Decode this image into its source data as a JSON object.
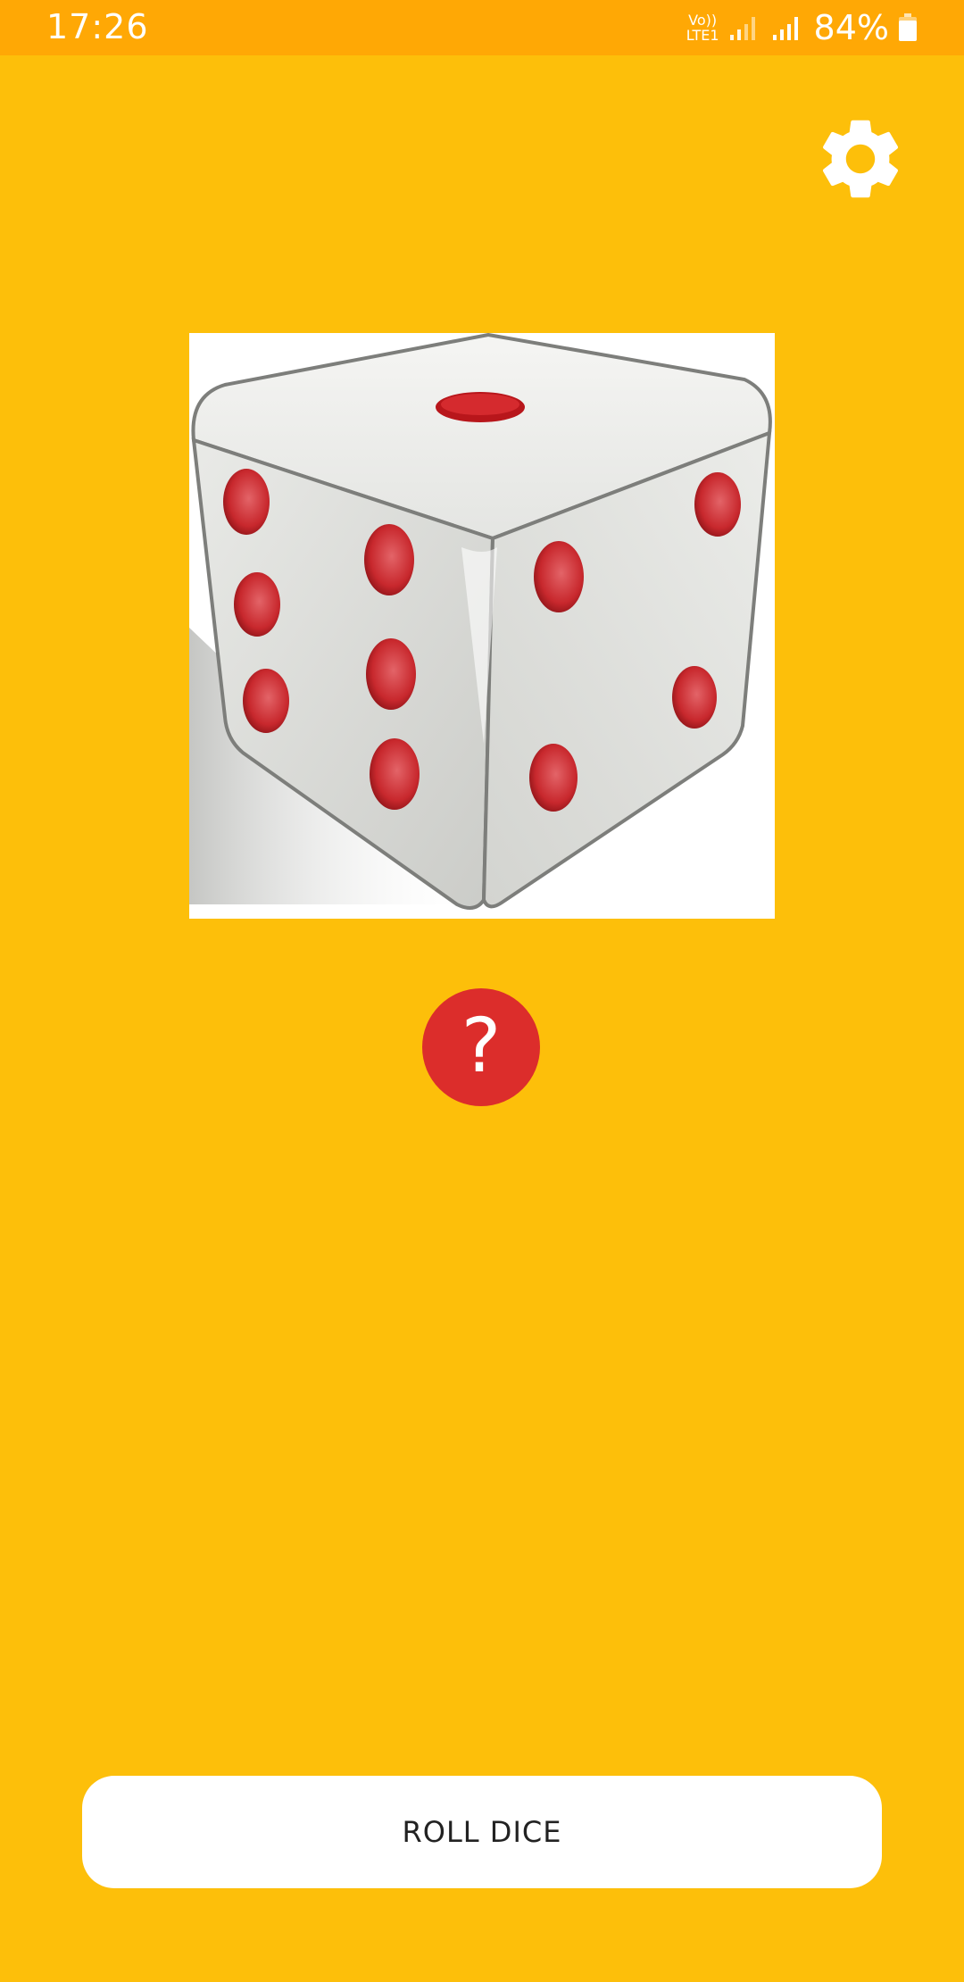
{
  "status_bar": {
    "time": "17:26",
    "network_line1": "Vo))",
    "network_line2": "LTE1",
    "battery": "84%",
    "icons": [
      "signal-icon",
      "signal-icon",
      "battery-icon"
    ]
  },
  "toolbar": {
    "settings_icon": "gear-icon"
  },
  "dice": {
    "icon": "dice-image"
  },
  "help": {
    "label": "?",
    "icon": "question-icon"
  },
  "actions": {
    "roll_label": "ROLL DICE"
  },
  "colors": {
    "background": "#FDBF0A",
    "status_bar": "#FFA805",
    "help_button": "#DC2D2B",
    "roll_button": "#FFFFFF",
    "dice_pip": "#C8282D"
  }
}
